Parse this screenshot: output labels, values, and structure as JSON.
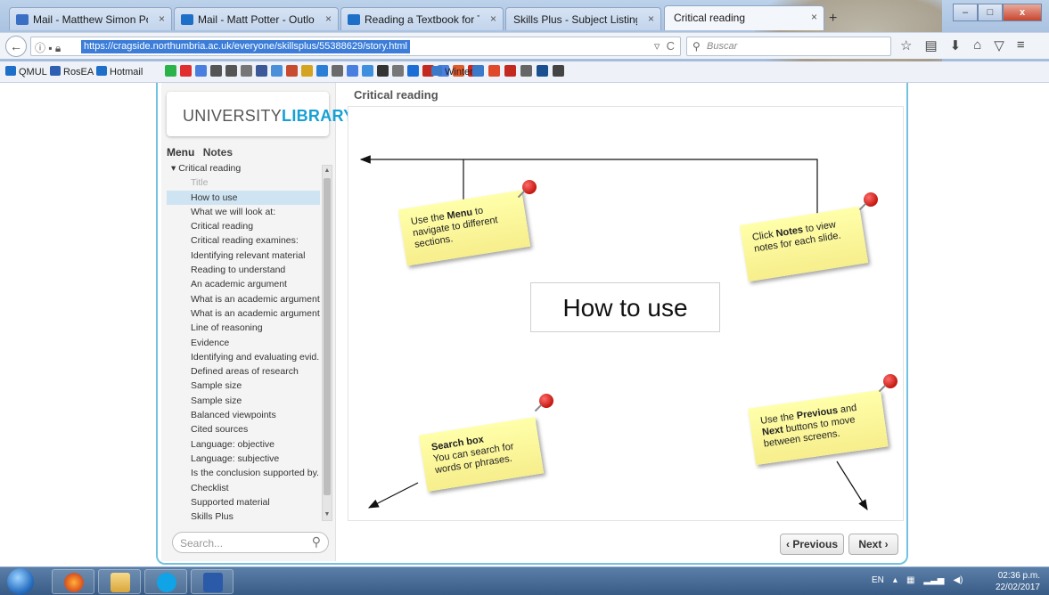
{
  "browser": {
    "tabs": [
      {
        "label": "Mail - Matthew Simon Pott...",
        "icon": "mail-icon",
        "icon_color": "#3a6fc4"
      },
      {
        "label": "Mail - Matt Potter - Outlook",
        "icon": "outlook-icon",
        "icon_color": "#1e6fc8"
      },
      {
        "label": "Reading a Textbook for Tru...",
        "icon": "outlook-icon",
        "icon_color": "#1e6fc8"
      },
      {
        "label": "Skills Plus - Subject Listing : No...",
        "icon": "page-icon",
        "icon_color": "#dde6f2"
      },
      {
        "label": "Critical reading",
        "icon": "page-icon",
        "icon_color": "#ffffff"
      }
    ],
    "tab_close": "×",
    "new_tab": "+",
    "url": "https://cragside.northumbria.ac.uk/everyone/skillsplus/55388629/story.html",
    "search_placeholder": "Buscar",
    "bookmarks": [
      {
        "label": "QMUL",
        "icon_color": "#1e6fc8"
      },
      {
        "label": "RosEA",
        "icon_color": "#2f5fb3"
      },
      {
        "label": "Hotmail",
        "icon_color": "#1e6fc8"
      },
      {
        "label": "Winter",
        "icon_color": "#3b79c9"
      }
    ]
  },
  "player": {
    "logo_part1": "UNIVERSITY",
    "logo_part2": "LIBRARY",
    "tab_menu": "Menu",
    "tab_notes": "Notes",
    "menu_items": [
      {
        "label": "Critical reading",
        "type": "parent"
      },
      {
        "label": "Title",
        "type": "muted"
      },
      {
        "label": "How to use",
        "type": "selected"
      },
      {
        "label": "What we will look at:"
      },
      {
        "label": "Critical reading"
      },
      {
        "label": "Critical reading examines:"
      },
      {
        "label": "Identifying relevant material"
      },
      {
        "label": "Reading to understand"
      },
      {
        "label": "An academic argument"
      },
      {
        "label": "What is an academic argument?"
      },
      {
        "label": "What is an academic argument?"
      },
      {
        "label": "Line of reasoning"
      },
      {
        "label": "Evidence"
      },
      {
        "label": "Identifying and evaluating evid..."
      },
      {
        "label": "Defined areas of research"
      },
      {
        "label": "Sample size"
      },
      {
        "label": "Sample size"
      },
      {
        "label": "Balanced viewpoints"
      },
      {
        "label": "Cited sources"
      },
      {
        "label": "Language: objective"
      },
      {
        "label": "Language: subjective"
      },
      {
        "label": "Is the conclusion supported by..."
      },
      {
        "label": "Checklist"
      },
      {
        "label": "Supported material"
      },
      {
        "label": "Skills Plus"
      }
    ],
    "search_placeholder": "Search...",
    "slide_title": "Critical reading",
    "slide_heading": "How to use",
    "notes": {
      "menu": {
        "pre": "Use the ",
        "bold": "Menu",
        "post": " to navigate to different sections."
      },
      "notes": {
        "pre": "Click ",
        "bold": "Notes",
        "post": " to view notes for each slide."
      },
      "search": {
        "bold": "Search box",
        "post": "You can search for words or phrases."
      },
      "nav": {
        "pre": "Use the ",
        "bold1": "Previous",
        "mid": " and ",
        "bold2": "Next",
        "post": " buttons to move between screens."
      }
    },
    "prev_label": "‹ Previous",
    "next_label": "Next ›",
    "accent_color": "#74c2e1",
    "note_color": "#f9f09a",
    "pin_color": "#d0261c"
  },
  "taskbar": {
    "apps": [
      "firefox-icon",
      "file-explorer-icon",
      "skype-icon",
      "word-icon"
    ],
    "lang": "EN",
    "time": "02:36 p.m.",
    "date": "22/02/2017"
  }
}
